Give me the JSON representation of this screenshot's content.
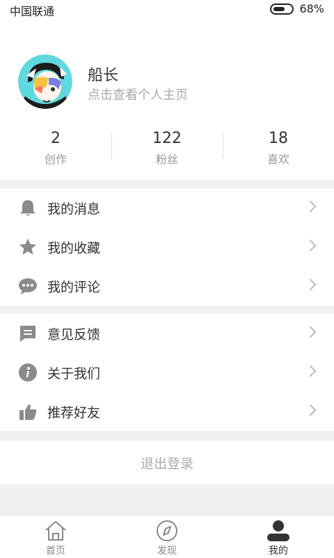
{
  "status_bar": {
    "carrier": "中国联通",
    "battery_percent": "68%"
  },
  "profile": {
    "name": "船长",
    "subtitle": "点击查看个人主页"
  },
  "stats": [
    {
      "value": "2",
      "label": "创作"
    },
    {
      "value": "122",
      "label": "粉丝"
    },
    {
      "value": "18",
      "label": "喜欢"
    }
  ],
  "menu_group1": [
    {
      "label": "我的消息",
      "icon": "bell-icon"
    },
    {
      "label": "我的收藏",
      "icon": "star-icon"
    },
    {
      "label": "我的评论",
      "icon": "comment-icon"
    }
  ],
  "menu_group2": [
    {
      "label": "意见反馈",
      "icon": "feedback-icon"
    },
    {
      "label": "关于我们",
      "icon": "info-icon"
    },
    {
      "label": "推荐好友",
      "icon": "thumbs-up-icon"
    }
  ],
  "logout_label": "退出登录",
  "bottom_nav": [
    {
      "label": "首页",
      "icon": "home-icon"
    },
    {
      "label": "发现",
      "icon": "compass-icon"
    },
    {
      "label": "我的",
      "icon": "user-icon",
      "active": true
    }
  ],
  "colors": {
    "icon_gray": "#8a8a8a",
    "background": "#f0f0f0",
    "text": "#333333",
    "muted": "#aaaaaa"
  }
}
